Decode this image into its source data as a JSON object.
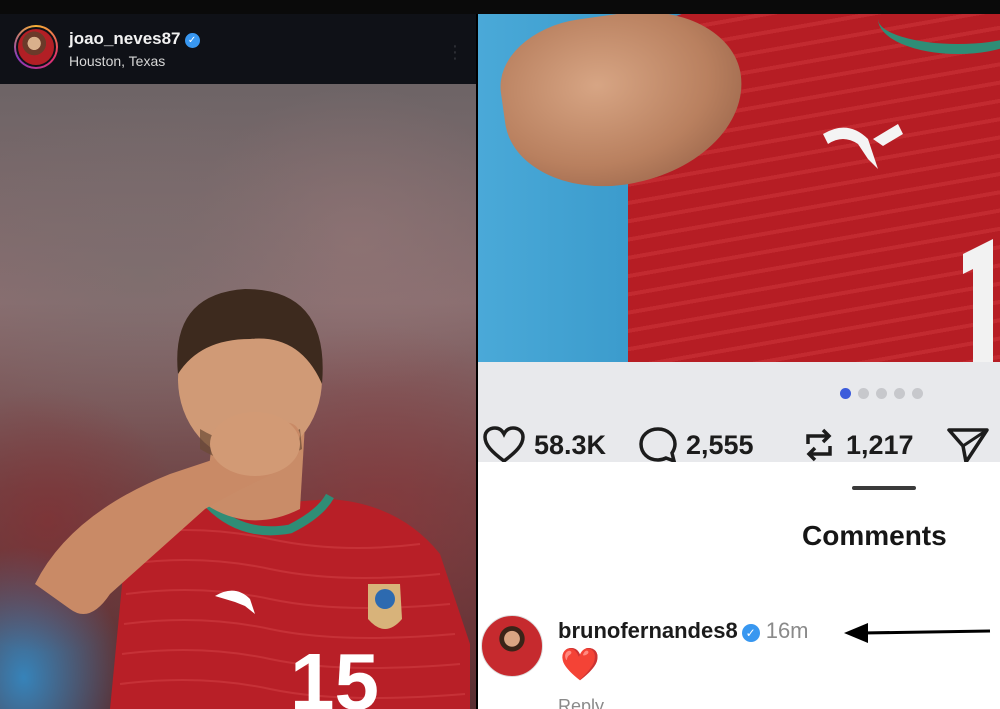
{
  "left_post": {
    "username": "joao_neves87",
    "location": "Houston, Texas",
    "more_icon": "more-dots-icon",
    "photo_description_icon": "photo"
  },
  "right_post": {
    "carousel": {
      "total": 5,
      "active": 1
    },
    "actions": {
      "likes": "58.3K",
      "comments": "2,555",
      "reposts": "1,217"
    },
    "sheet": {
      "title": "Comments"
    },
    "comment": {
      "username": "brunofernandes8",
      "time": "16m",
      "emoji": "❤️",
      "reply_label": "Reply"
    }
  },
  "colors": {
    "verified": "#3897f0",
    "active_dot": "#3b5bdb",
    "heart": "#e8232f"
  }
}
